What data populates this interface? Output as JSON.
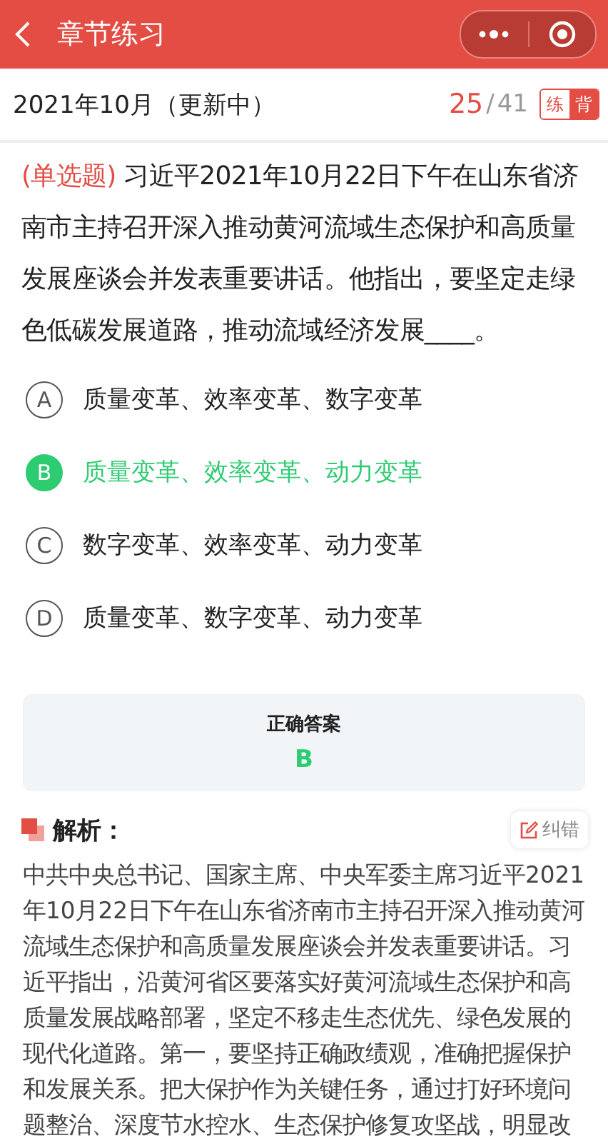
{
  "header": {
    "title": "章节练习"
  },
  "chapter": {
    "title": "2021年10月（更新中）",
    "current": "25",
    "separator": "/",
    "total": "41",
    "modes": [
      {
        "label": "练",
        "selected": false
      },
      {
        "label": "背",
        "selected": true
      }
    ]
  },
  "question": {
    "type_label": "(单选题)",
    "text": "习近平2021年10月22日下午在山东省济南市主持召开深入推动黄河流域生态保护和高质量发展座谈会并发表重要讲话。他指出，要坚定走绿色低碳发展道路，推动流域经济发展____。"
  },
  "options": [
    {
      "letter": "A",
      "text": "质量变革、效率变革、数字变革",
      "selected": false
    },
    {
      "letter": "B",
      "text": "质量变革、效率变革、动力变革",
      "selected": true
    },
    {
      "letter": "C",
      "text": "数字变革、效率变革、动力变革",
      "selected": false
    },
    {
      "letter": "D",
      "text": "质量变革、数字变革、动力变革",
      "selected": false
    }
  ],
  "answer": {
    "label": "正确答案",
    "value": "B"
  },
  "analysis": {
    "title": "解析：",
    "report_button": "纠错",
    "text": "中共中央总书记、国家主席、中央军委主席习近平2021年10月22日下午在山东省济南市主持召开深入推动黄河流域生态保护和高质量发展座谈会并发表重要讲话。习近平指出，沿黄河省区要落实好黄河流域生态保护和高质量发展战略部署，坚定不移走生态优先、绿色发展的现代化道路。第一，要坚持正确政绩观，准确把握保护和发展关系。把大保护作为关键任务，通过打好环境问题整治、深度节水控水、生态保护修复攻坚战，明显改"
  }
}
